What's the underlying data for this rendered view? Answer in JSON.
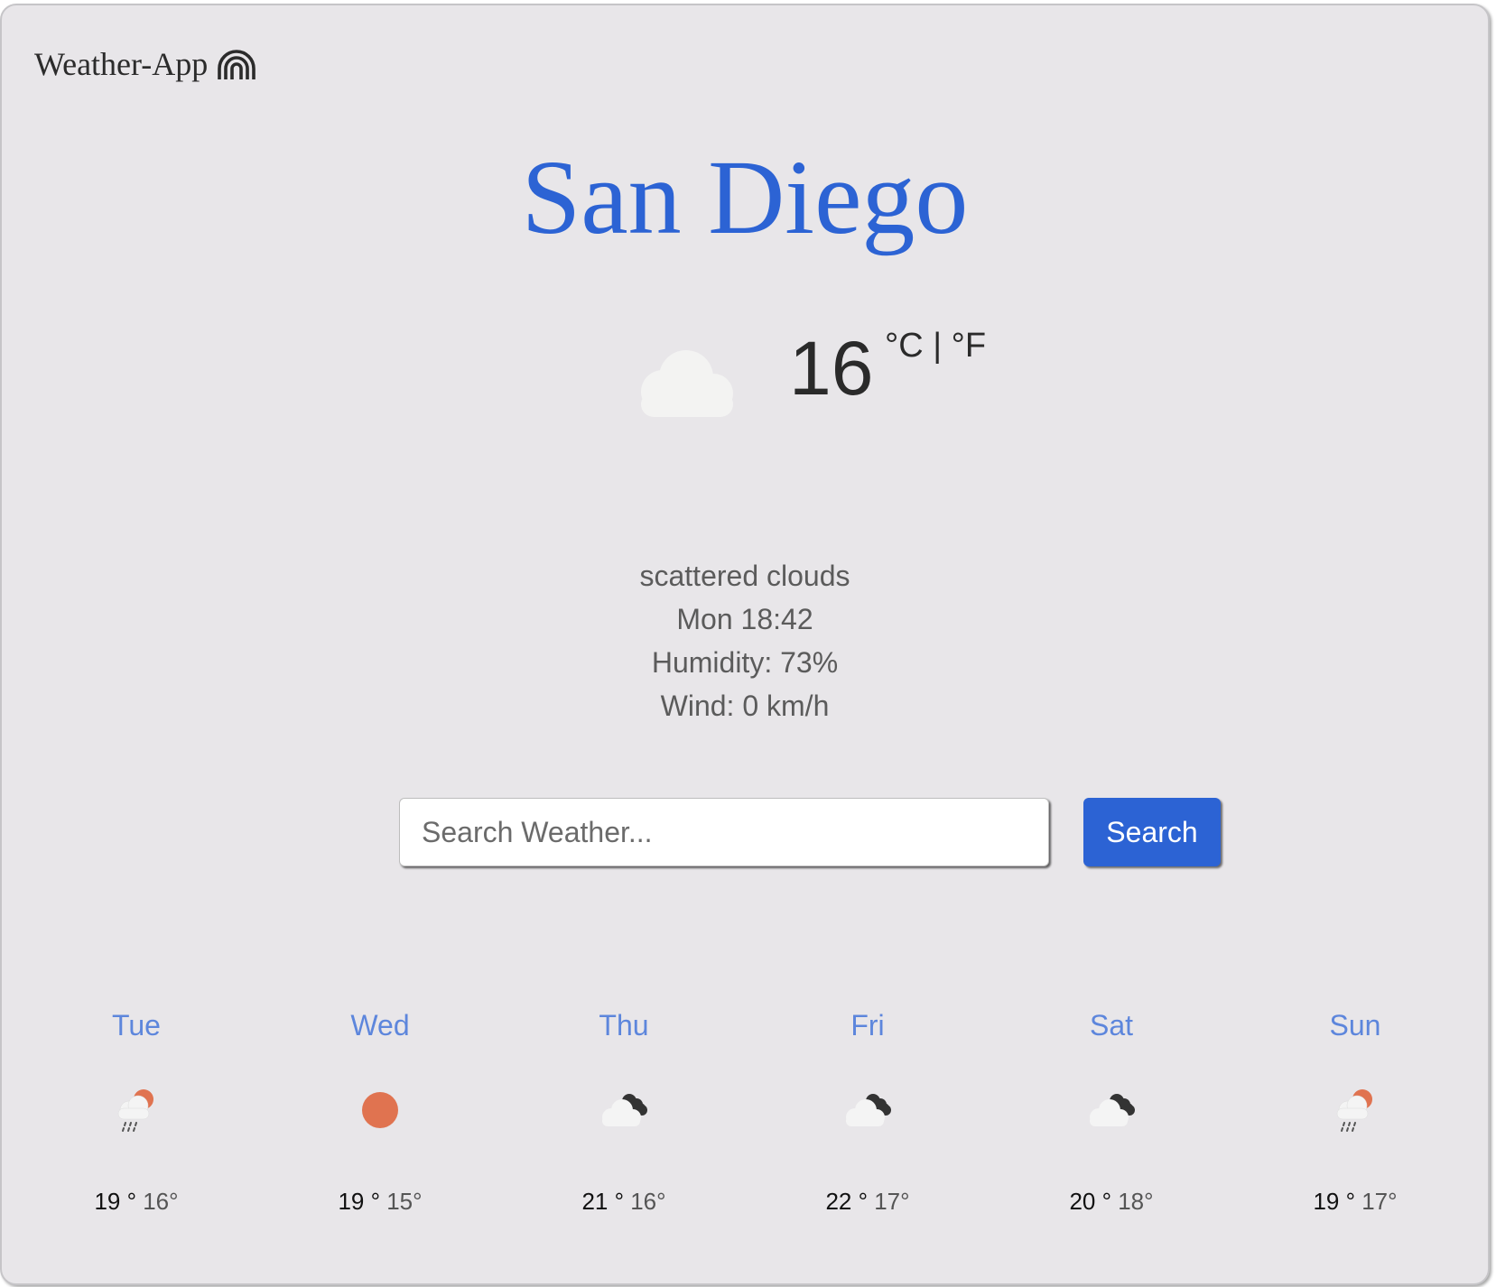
{
  "brand": {
    "name": "Weather-App",
    "icon": "rainbow-icon"
  },
  "city": "San Diego",
  "current": {
    "icon": "cloud-icon",
    "temperature": "16",
    "unit_celsius": "°C",
    "unit_separator": "|",
    "unit_fahrenheit": "°F",
    "description": "scattered clouds",
    "datetime": "Mon 18:42",
    "humidity": "Humidity: 73%",
    "wind": "Wind: 0 km/h"
  },
  "search": {
    "placeholder": "Search Weather...",
    "value": "",
    "button_label": "Search"
  },
  "forecast": [
    {
      "day": "Tue",
      "icon": "rain-sun-icon",
      "max": "19 °",
      "min": "16°"
    },
    {
      "day": "Wed",
      "icon": "sun-icon",
      "max": "19 °",
      "min": "15°"
    },
    {
      "day": "Thu",
      "icon": "broken-clouds-icon",
      "max": "21 °",
      "min": "16°"
    },
    {
      "day": "Fri",
      "icon": "broken-clouds-icon",
      "max": "22 °",
      "min": "17°"
    },
    {
      "day": "Sat",
      "icon": "broken-clouds-icon",
      "max": "20 °",
      "min": "18°"
    },
    {
      "day": "Sun",
      "icon": "rain-sun-icon",
      "max": "19 °",
      "min": "17°"
    }
  ],
  "colors": {
    "background": "#e8e6e9",
    "accent": "#2c63d4",
    "day_label": "#5d86dc",
    "sun": "#e07350"
  }
}
